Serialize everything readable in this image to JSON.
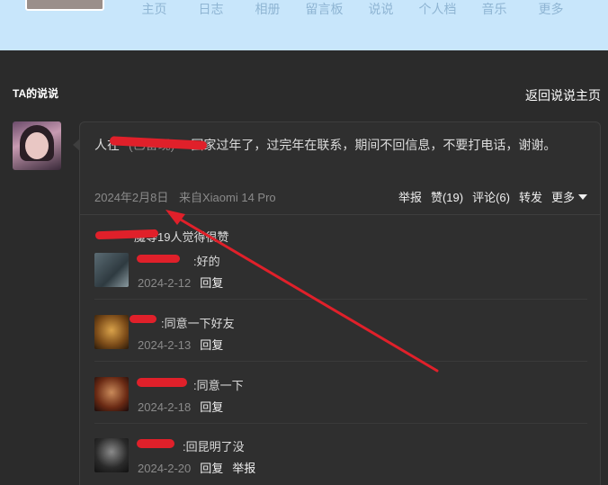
{
  "nav": {
    "items": [
      "主页",
      "日志",
      "相册",
      "留言板",
      "说说",
      "个人档",
      "音乐",
      "更多"
    ]
  },
  "header": {
    "section_title": "TA的说说",
    "back_link": "返回说说主页"
  },
  "post": {
    "author_visible": "人在",
    "author_tail": "(已备现)",
    "text": "回家过年了，过完年在联系，期间不回信息，不要打电话，谢谢。",
    "date": "2024年2月8日",
    "device": "来自Xiaomi 14 Pro",
    "actions": {
      "report": "举报",
      "like": "赞(19)",
      "comment": "评论(6)",
      "forward": "转发",
      "more": "更多"
    },
    "likes_text": "等19人觉得很赞",
    "likes_name_tail": "魔"
  },
  "comments": [
    {
      "name": "",
      "text": "好的",
      "date": "2024-2-12",
      "reply": "回复",
      "report": ""
    },
    {
      "name": "",
      "text": "同意一下好友",
      "date": "2024-2-13",
      "reply": "回复",
      "report": ""
    },
    {
      "name": "",
      "text": "同意一下",
      "date": "2024-2-18",
      "reply": "回复",
      "report": ""
    },
    {
      "name": "",
      "text": "回昆明了没",
      "date": "2024-2-20",
      "reply": "回复",
      "report": "举报"
    }
  ],
  "colors": {
    "banner": "#c8e6fb",
    "background": "#2b2b2b",
    "annotation": "#e0202a"
  }
}
